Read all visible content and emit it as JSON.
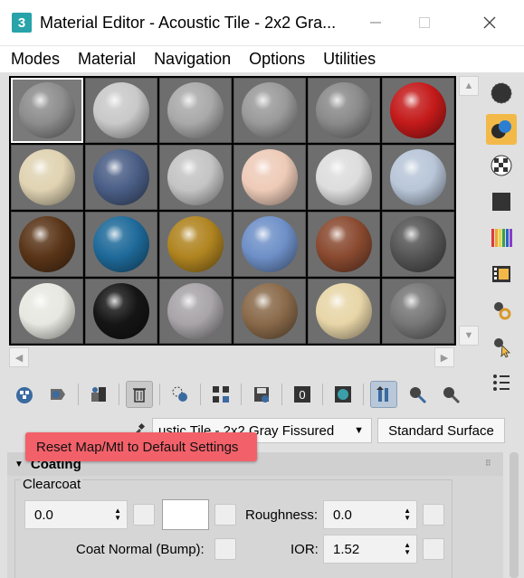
{
  "window": {
    "title": "Material Editor - Acoustic Tile - 2x2 Gra...",
    "app_icon_label": "3"
  },
  "menu": [
    "Modes",
    "Material",
    "Navigation",
    "Options",
    "Utilities"
  ],
  "slots": [
    {
      "color": "#8d8d8d"
    },
    {
      "color": "#c9c9c9"
    },
    {
      "color": "#a9a9a9"
    },
    {
      "color": "#9a9a9a"
    },
    {
      "color": "#8a8a8a"
    },
    {
      "color": "#c41a1a"
    },
    {
      "color": "#e0d3b2"
    },
    {
      "color": "#4a5e86"
    },
    {
      "color": "#c4c4c4"
    },
    {
      "color": "#eecbb8"
    },
    {
      "color": "#dddddd"
    },
    {
      "color": "#b8c6d8"
    },
    {
      "color": "#5a3518"
    },
    {
      "color": "#1e6a9a"
    },
    {
      "color": "#b08420"
    },
    {
      "color": "#6e90c8"
    },
    {
      "color": "#8a4a30"
    },
    {
      "color": "#555555"
    },
    {
      "color": "#e8e8e2"
    },
    {
      "color": "#151515"
    },
    {
      "color": "#a8a4a8"
    },
    {
      "color": "#8a6a4a"
    },
    {
      "color": "#e8d6a8"
    },
    {
      "color": "#777777"
    }
  ],
  "tooltip": "Reset Map/Mtl to Default Settings",
  "material": {
    "name": "ustic Tile - 2x2 Gray Fissured",
    "type": "Standard Surface"
  },
  "rollout": {
    "title": "Coating",
    "group": "Clearcoat",
    "clearcoat_value": "0.0",
    "roughness_label": "Roughness:",
    "roughness_value": "0.0",
    "coat_normal_label": "Coat Normal (Bump):",
    "ior_label": "IOR:",
    "ior_value": "1.52"
  },
  "colors": {
    "highlight": "#f3b948",
    "tooltip_bg": "#f2616a"
  }
}
